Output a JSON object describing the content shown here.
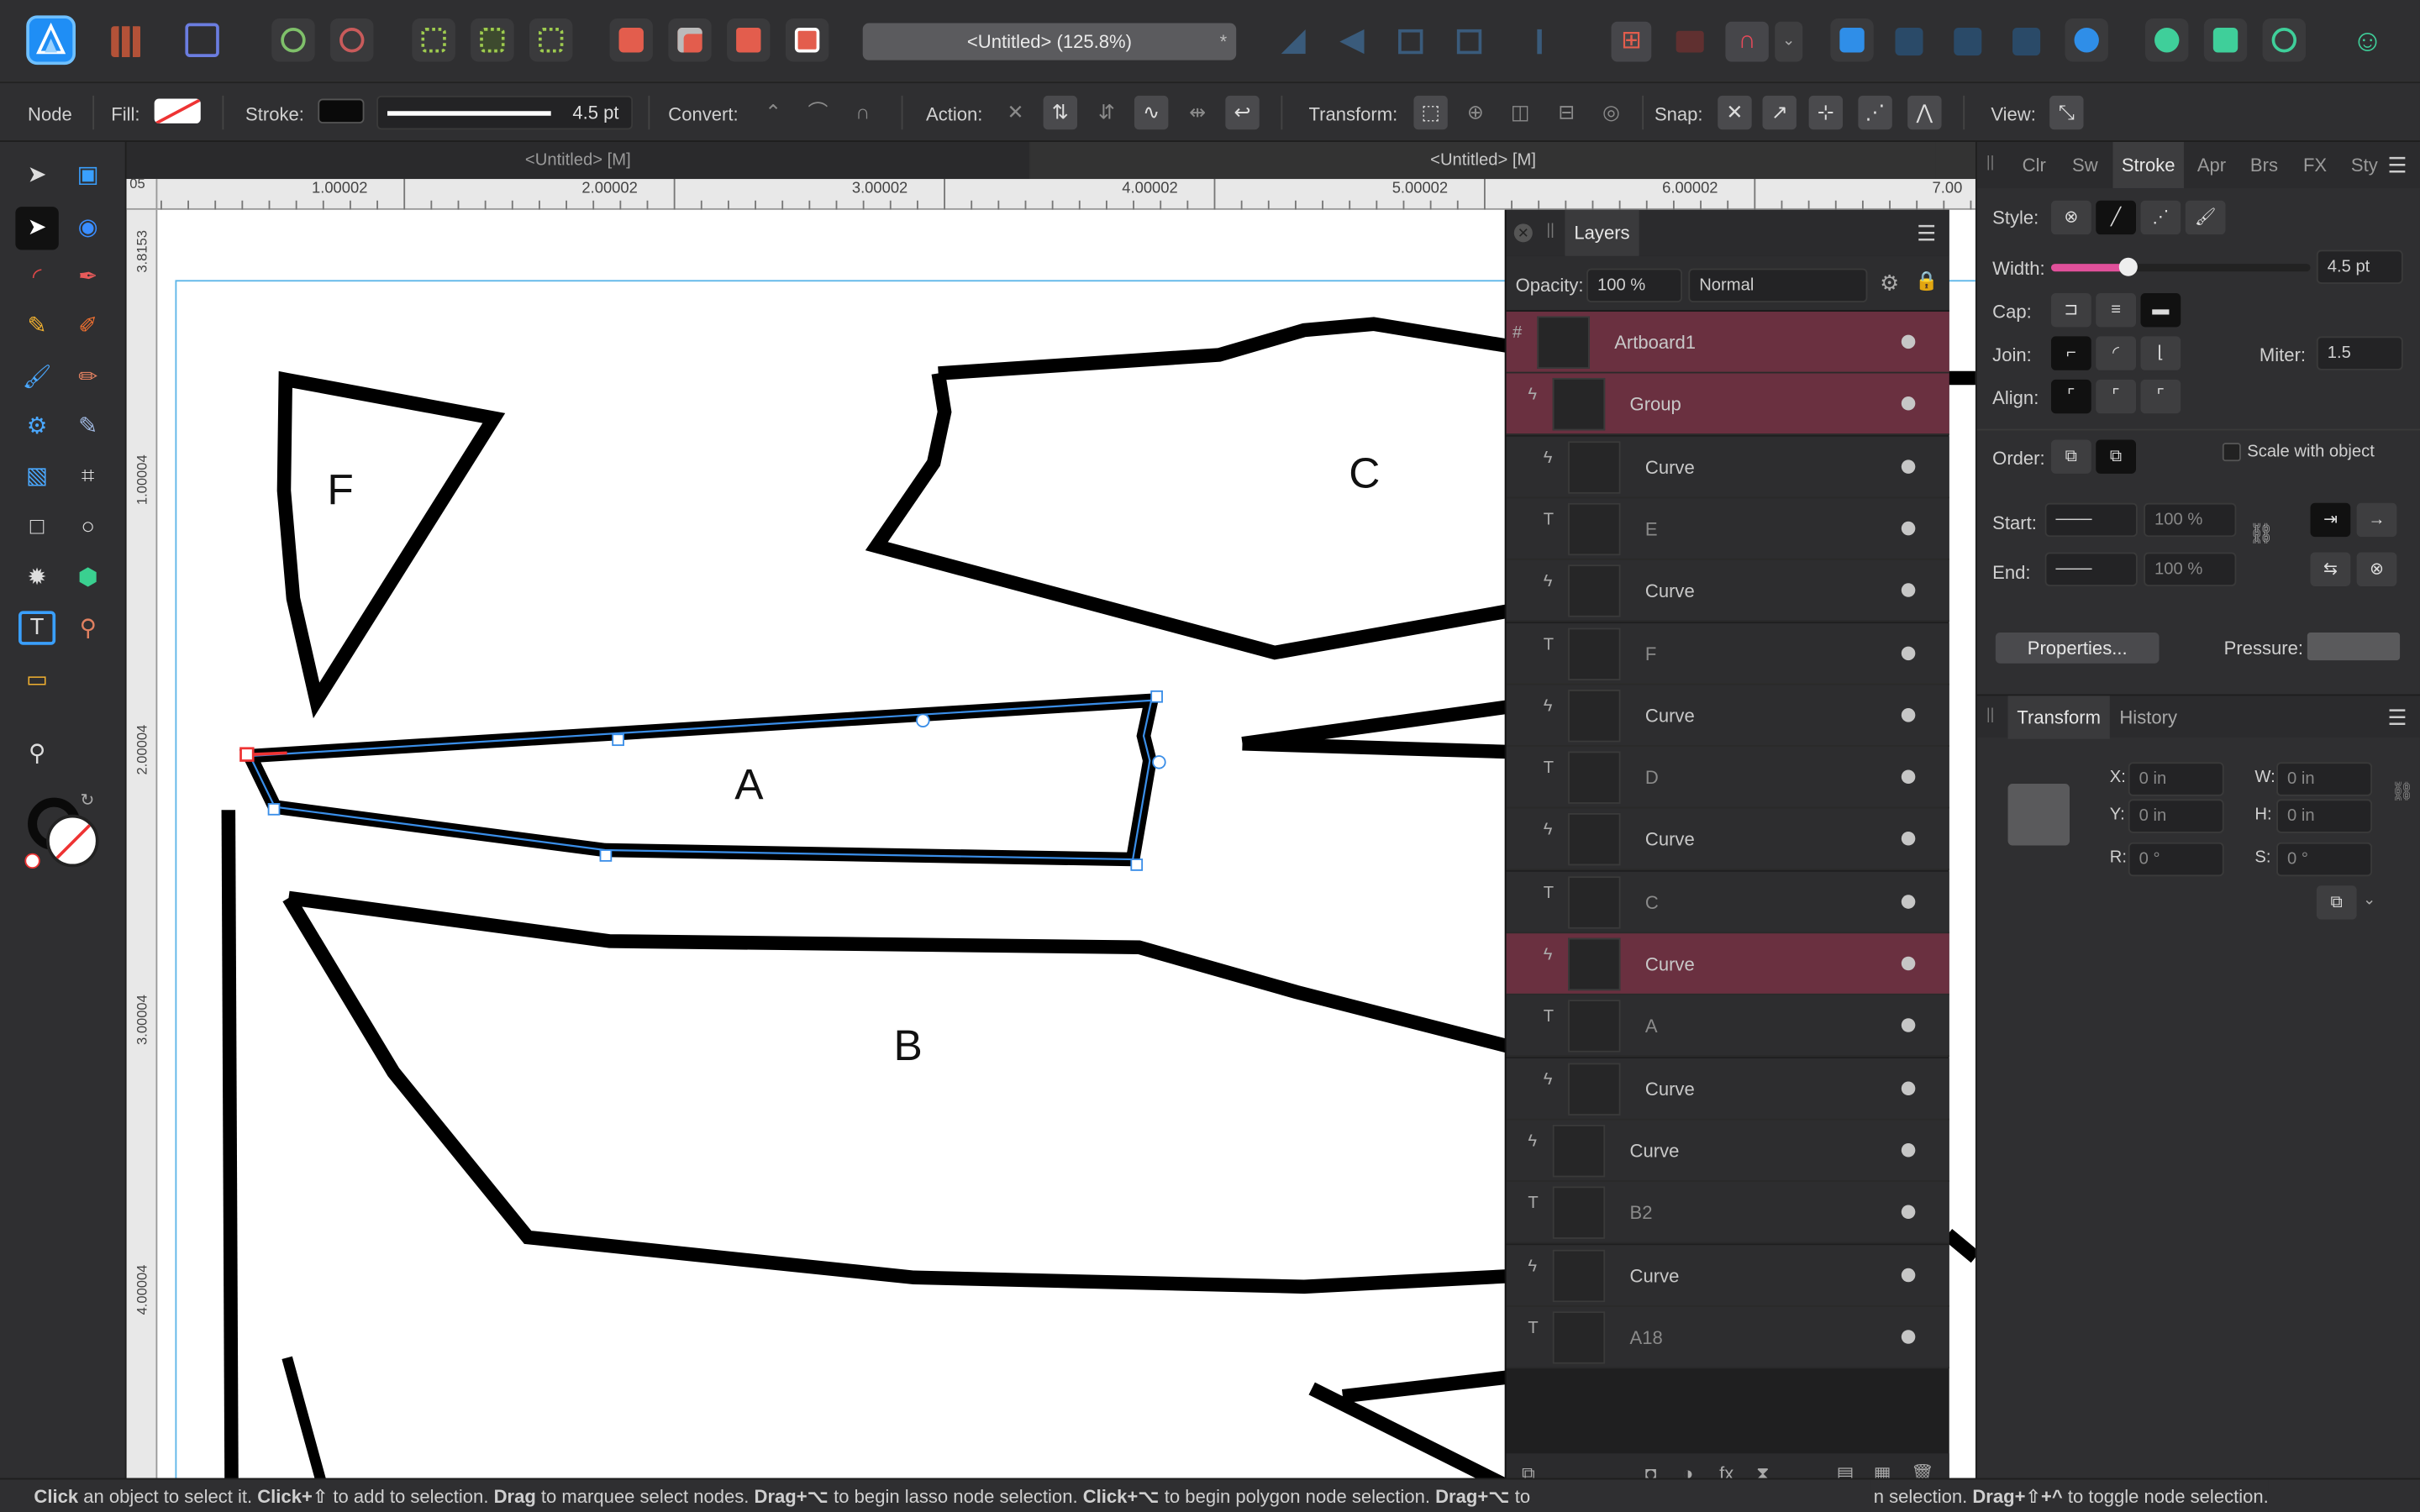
{
  "app": {
    "document_title": "<Untitled> (125.8%)",
    "modified_marker": "*"
  },
  "context_toolbar": {
    "mode_label": "Node",
    "fill_label": "Fill:",
    "stroke_label": "Stroke:",
    "stroke_width": "4.5 pt",
    "convert_label": "Convert:",
    "action_label": "Action:",
    "transform_label": "Transform:",
    "snap_label": "Snap:",
    "view_label": "View:"
  },
  "doc_tabs": [
    "<Untitled> [M]",
    "<Untitled> [M]"
  ],
  "rulers": {
    "h_ticks": [
      "1.00002",
      "2.00002",
      "3.00002",
      "4.00002",
      "5.00002",
      "6.00002",
      "7.00"
    ],
    "v_ticks": [
      "3.8153",
      "1.00004",
      "2.00004",
      "3.00004",
      "4.00004"
    ],
    "corner": "05"
  },
  "canvas": {
    "shape_labels": {
      "a": "A",
      "b": "B",
      "c": "C",
      "f": "F"
    }
  },
  "layers_panel": {
    "title": "Layers",
    "opacity_label": "Opacity:",
    "opacity_value": "100 %",
    "blend_mode": "Normal",
    "rows": [
      {
        "name": "Artboard1",
        "selected": true
      },
      {
        "name": "Group",
        "selected": true
      },
      {
        "name": "Curve"
      },
      {
        "name": "E"
      },
      {
        "name": "Curve"
      },
      {
        "name": "F"
      },
      {
        "name": "Curve"
      },
      {
        "name": "D"
      },
      {
        "name": "Curve"
      },
      {
        "name": "C"
      },
      {
        "name": "Curve",
        "selected": true
      },
      {
        "name": "A"
      },
      {
        "name": "Curve"
      },
      {
        "name": "Curve"
      },
      {
        "name": "B2"
      },
      {
        "name": "Curve"
      },
      {
        "name": "A18"
      }
    ]
  },
  "stroke_panel": {
    "tabs": [
      "Clr",
      "Sw",
      "Stroke",
      "Apr",
      "Brs",
      "FX",
      "Sty"
    ],
    "active_tab": "Stroke",
    "style_label": "Style:",
    "width_label": "Width:",
    "width_value": "4.5 pt",
    "width_fraction": 0.3,
    "cap_label": "Cap:",
    "join_label": "Join:",
    "miter_label": "Miter:",
    "miter_value": "1.5",
    "align_label": "Align:",
    "order_label": "Order:",
    "scale_label": "Scale with object",
    "start_label": "Start:",
    "start_pct": "100 %",
    "end_label": "End:",
    "end_pct": "100 %",
    "properties_button": "Properties...",
    "pressure_label": "Pressure:"
  },
  "transform_panel": {
    "tabs": [
      "Transform",
      "History"
    ],
    "x_label": "X:",
    "x_value": "0 in",
    "y_label": "Y:",
    "y_value": "0 in",
    "w_label": "W:",
    "w_value": "0 in",
    "h_label": "H:",
    "h_value": "0 in",
    "r_label": "R:",
    "r_value": "0 °",
    "s_label": "S:",
    "s_value": "0 °"
  },
  "status_bar": {
    "segments": [
      {
        "b": "Click",
        "t": " an object to select it. "
      },
      {
        "b": "Click+⇧",
        "t": " to add to selection. "
      },
      {
        "b": "Drag",
        "t": " to marquee select nodes. "
      },
      {
        "b": "Drag+⌥",
        "t": " to begin lasso node selection. "
      },
      {
        "b": "Click+⌥",
        "t": " to begin polygon node selection. "
      },
      {
        "b": "Drag+⌥",
        "t": " to"
      }
    ],
    "tail": "n selection. ",
    "tail_b": "Drag+⇧+^",
    "tail_t": " to toggle node selection."
  },
  "colors": {
    "accent": "#4a8cf0",
    "selection": "#6a3040",
    "affinity_blue": "#1f8ef5",
    "width_slider": "#e0509a"
  }
}
